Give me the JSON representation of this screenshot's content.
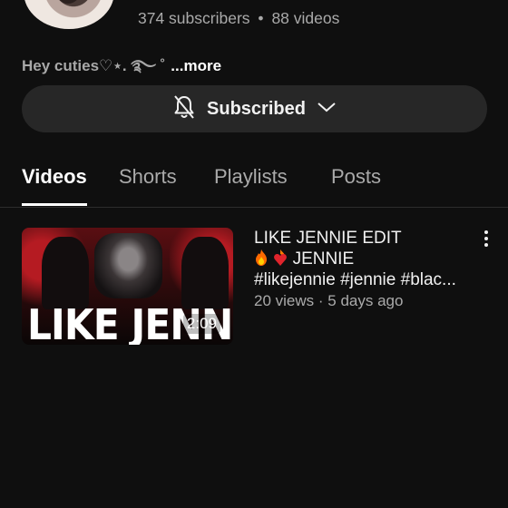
{
  "channel": {
    "subscribers": "374 subscribers",
    "separator": "•",
    "videos_count": "88 videos",
    "bio": "Hey cuties♡⋆. ࿐ ˚",
    "more_label": "...more"
  },
  "subscribe_button": {
    "label": "Subscribed",
    "icon": "bell-off-icon"
  },
  "tabs": [
    {
      "label": "Videos",
      "active": true
    },
    {
      "label": "Shorts",
      "active": false
    },
    {
      "label": "Playlists",
      "active": false
    },
    {
      "label": "Posts",
      "active": false
    }
  ],
  "videos": [
    {
      "thumbnail_text": "LIKE JENNIE",
      "duration": "2:09",
      "title_line1": "LIKE JENNIE EDIT",
      "title_line2": "JENNIE",
      "title_line3": "#likejennie #jennie #blac...",
      "views": "20 views",
      "age": "5 days ago",
      "separator": "·"
    }
  ],
  "colors": {
    "background": "#0f0f0f",
    "button_bg": "#272727",
    "muted_text": "#aaaaaa"
  }
}
